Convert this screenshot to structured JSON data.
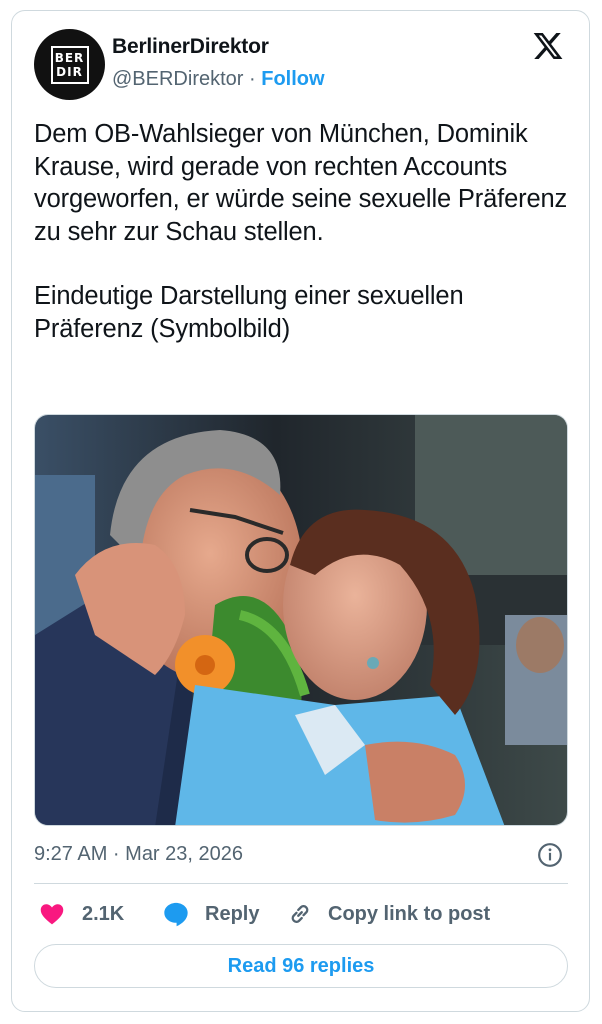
{
  "author": {
    "avatar_lines": [
      "BER",
      "DIR"
    ],
    "display_name": "BerlinerDirektor",
    "handle": "@BERDirektor",
    "separator": "·",
    "follow_label": "Follow"
  },
  "post": {
    "paragraphs": [
      "Dem OB-Wahlsieger von München, Dominik Krause, wird gerade von rechten Accounts vorgeworfen, er würde seine sexuelle Präferenz zu sehr zur Schau stellen.",
      "Eindeutige Darstellung einer sexuellen Präferenz (Symbolbild)"
    ],
    "timestamp": "9:27 AM · Mar 23, 2026"
  },
  "actions": {
    "like_count": "2.1K",
    "reply_label": "Reply",
    "copy_label": "Copy link to post"
  },
  "read_replies_label": "Read 96 replies",
  "colors": {
    "accent": "#1d9bf0",
    "like": "#f91880",
    "muted": "#536471",
    "border": "#cfd9de"
  },
  "icons": [
    "x-logo-icon",
    "info-icon",
    "heart-icon",
    "reply-bubble-icon",
    "link-icon"
  ]
}
